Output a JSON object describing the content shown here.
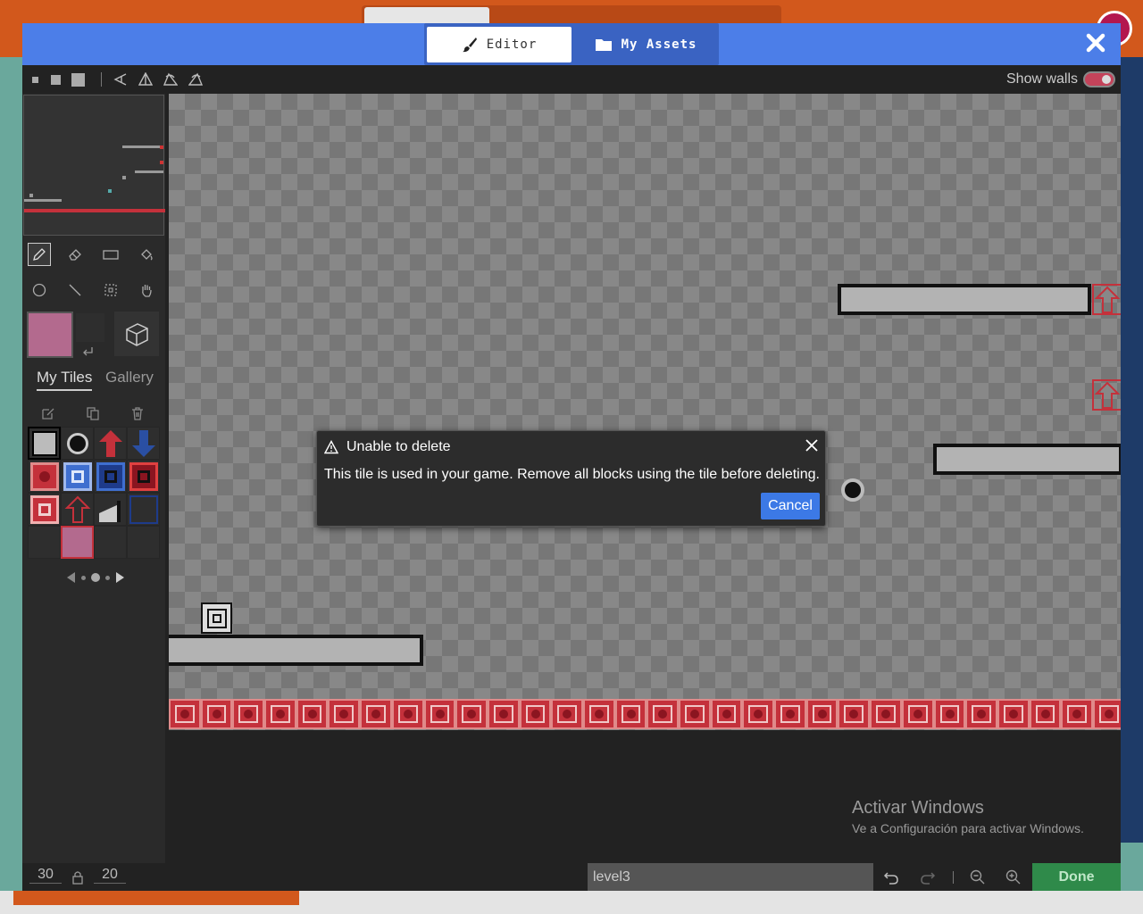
{
  "modal": {
    "tabs": [
      {
        "label": "Editor"
      },
      {
        "label": "My Assets"
      }
    ],
    "toolbar": {
      "show_walls_label": "Show walls",
      "show_walls_on": true
    }
  },
  "side": {
    "tabs": [
      {
        "label": "My Tiles"
      },
      {
        "label": "Gallery"
      }
    ],
    "tools": [
      "pencil-icon",
      "eraser-icon",
      "rectangle-icon",
      "fill-icon",
      "circle-icon",
      "line-icon",
      "marquee-icon",
      "pan-icon"
    ],
    "tile_actions": [
      "edit-tile-icon",
      "duplicate-tile-icon",
      "delete-tile-icon"
    ]
  },
  "dialog": {
    "title": "Unable to delete",
    "message": "This tile is used in your game. Remove all blocks using the tile before deleting.",
    "cancel_label": "Cancel"
  },
  "bottom_bar": {
    "width_value": "30",
    "height_value": "20",
    "level_name": "level3",
    "done_label": "Done"
  },
  "watermark": {
    "title": "Activar Windows",
    "subtitle": "Ve a Configuración para activar Windows."
  },
  "colors": {
    "header_blue": "#4c7ee8",
    "done_green": "#2f8a4a",
    "cancel_blue": "#3c79e6",
    "tile_pink": "#b36a8e",
    "tile_red": "#c4313b"
  }
}
